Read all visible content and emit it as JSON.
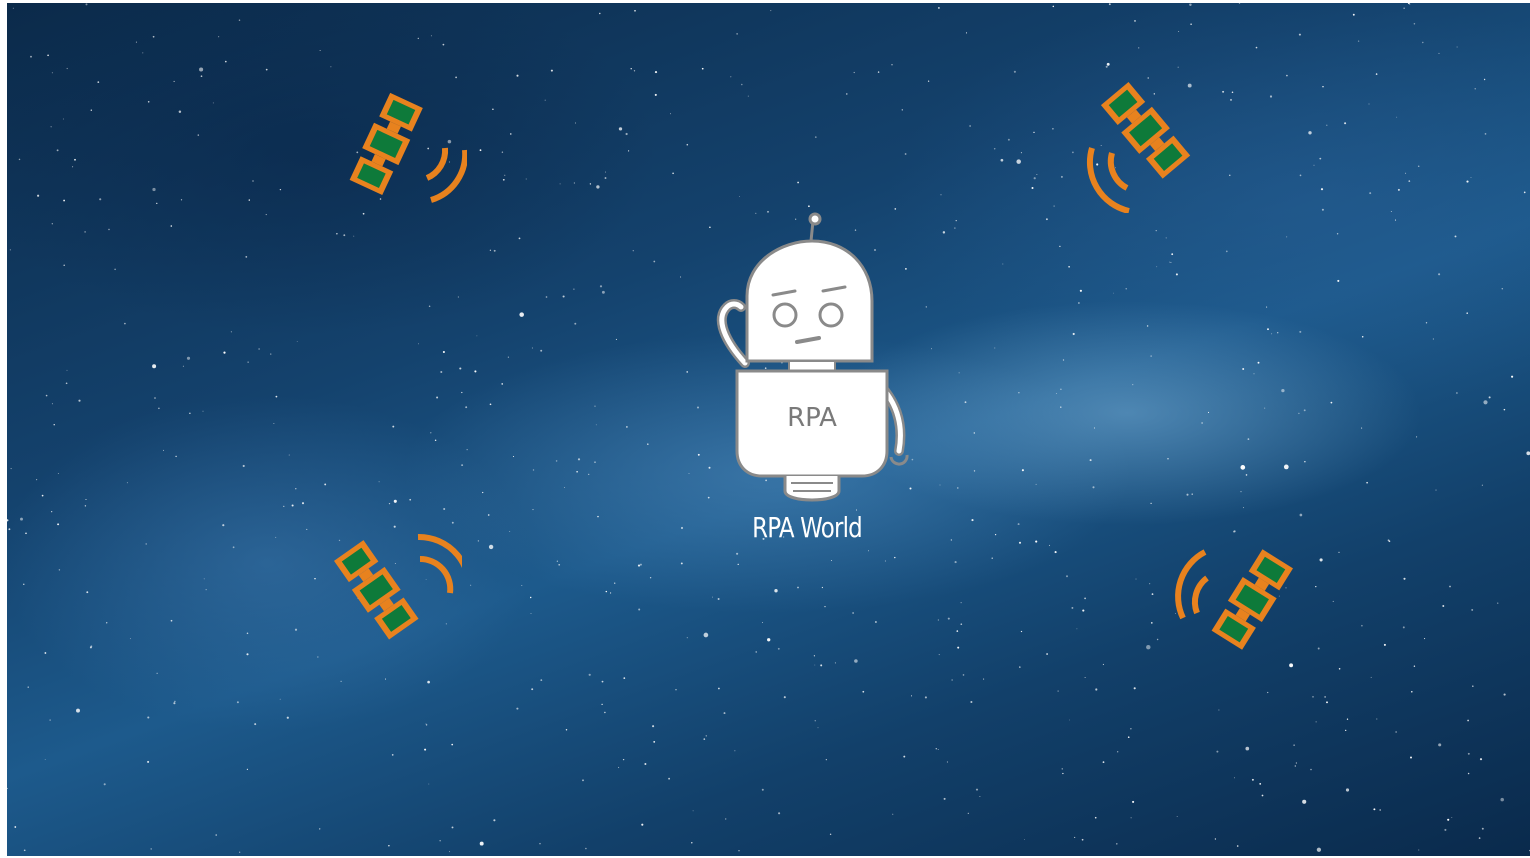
{
  "scene": {
    "title": "RPA World",
    "robot_badge": "RPA"
  },
  "colors": {
    "satellite_frame": "#e8821e",
    "satellite_panel": "#0e7a3a",
    "signal": "#e8821e",
    "robot_outline": "#8a8a8a",
    "robot_fill": "#ffffff",
    "space_dark": "#0b2a4a",
    "space_light": "#1d5a8c"
  },
  "icons": {
    "satellites": [
      "satellite-icon",
      "satellite-icon",
      "satellite-icon",
      "satellite-icon"
    ],
    "robot": "robot-icon"
  }
}
